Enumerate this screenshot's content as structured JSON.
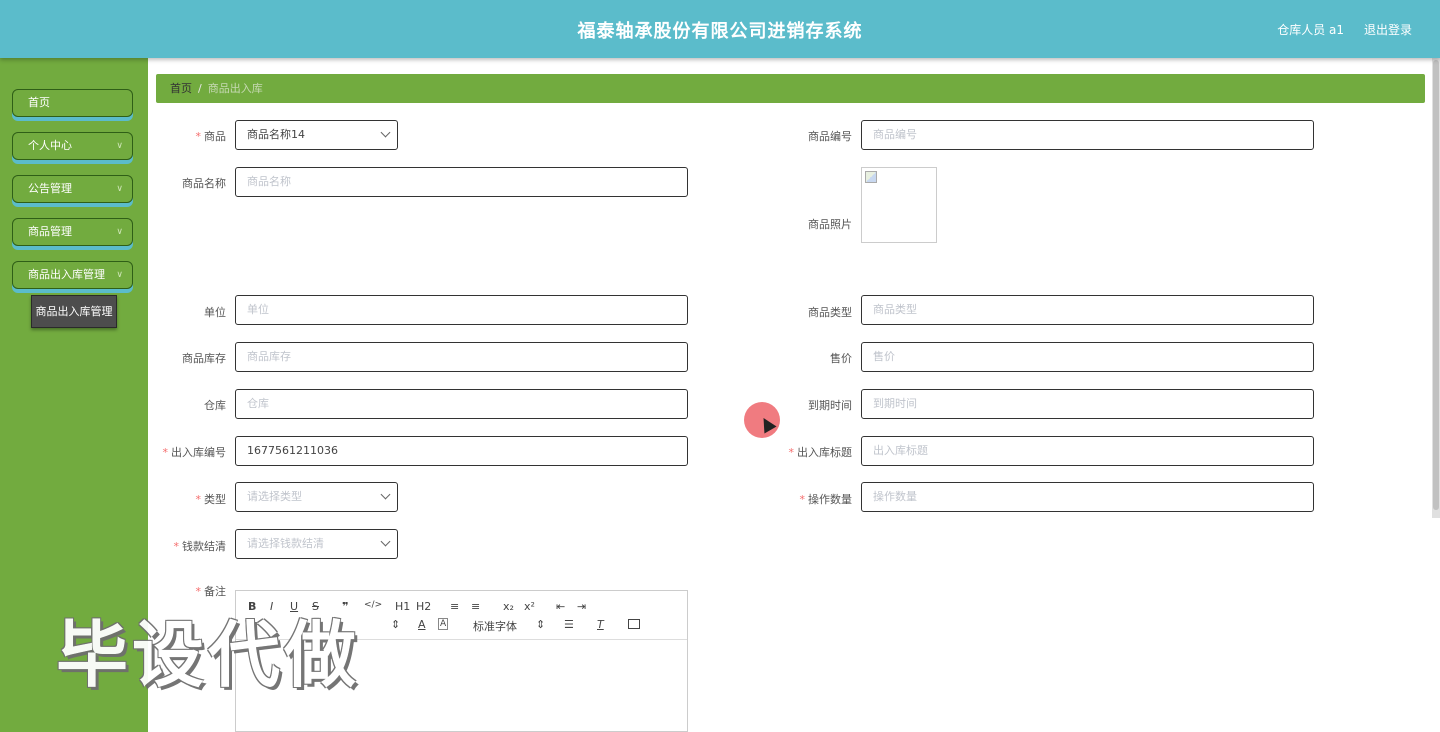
{
  "header": {
    "title": "福泰轴承股份有限公司进销存系统",
    "user": "仓库人员 a1",
    "logout": "退出登录"
  },
  "sidebar": {
    "items": [
      {
        "label": "首页"
      },
      {
        "label": "个人中心"
      },
      {
        "label": "公告管理"
      },
      {
        "label": "商品管理"
      },
      {
        "label": "商品出入库管理"
      }
    ],
    "submenu": {
      "label": "商品出入库管理"
    }
  },
  "breadcrumb": {
    "home": "首页",
    "separator": "/",
    "current": "商品出入库"
  },
  "form": {
    "product": {
      "label": "商品",
      "value": "商品名称14"
    },
    "product_no": {
      "label": "商品编号",
      "placeholder": "商品编号"
    },
    "product_name": {
      "label": "商品名称",
      "placeholder": "商品名称"
    },
    "product_photo": {
      "label": "商品照片"
    },
    "unit": {
      "label": "单位",
      "placeholder": "单位"
    },
    "product_type": {
      "label": "商品类型",
      "placeholder": "商品类型"
    },
    "stock": {
      "label": "商品库存",
      "placeholder": "商品库存"
    },
    "price": {
      "label": "售价",
      "placeholder": "售价"
    },
    "warehouse": {
      "label": "仓库",
      "placeholder": "仓库"
    },
    "expire": {
      "label": "到期时间",
      "placeholder": "到期时间"
    },
    "io_no": {
      "label": "出入库编号",
      "value": "1677561211036"
    },
    "io_title": {
      "label": "出入库标题",
      "placeholder": "出入库标题"
    },
    "type": {
      "label": "类型",
      "placeholder": "请选择类型"
    },
    "quantity": {
      "label": "操作数量",
      "placeholder": "操作数量"
    },
    "settled": {
      "label": "钱款结清",
      "placeholder": "请选择钱款结清"
    },
    "remark": {
      "label": "备注"
    }
  },
  "editor": {
    "tools_row1": [
      "B",
      "I",
      "U",
      "S",
      "❞",
      "</>",
      "H1",
      "H2",
      "≡",
      "≡",
      "x₂",
      "x²",
      "⇤",
      "⇥"
    ],
    "tools_row2_font": "标准字体"
  },
  "watermark": "毕设代做",
  "colors": {
    "header": "#5bbccb",
    "sidebar": "#72ab3f",
    "breadcrumb": "#72ab3f",
    "required": "#f56c6c"
  }
}
